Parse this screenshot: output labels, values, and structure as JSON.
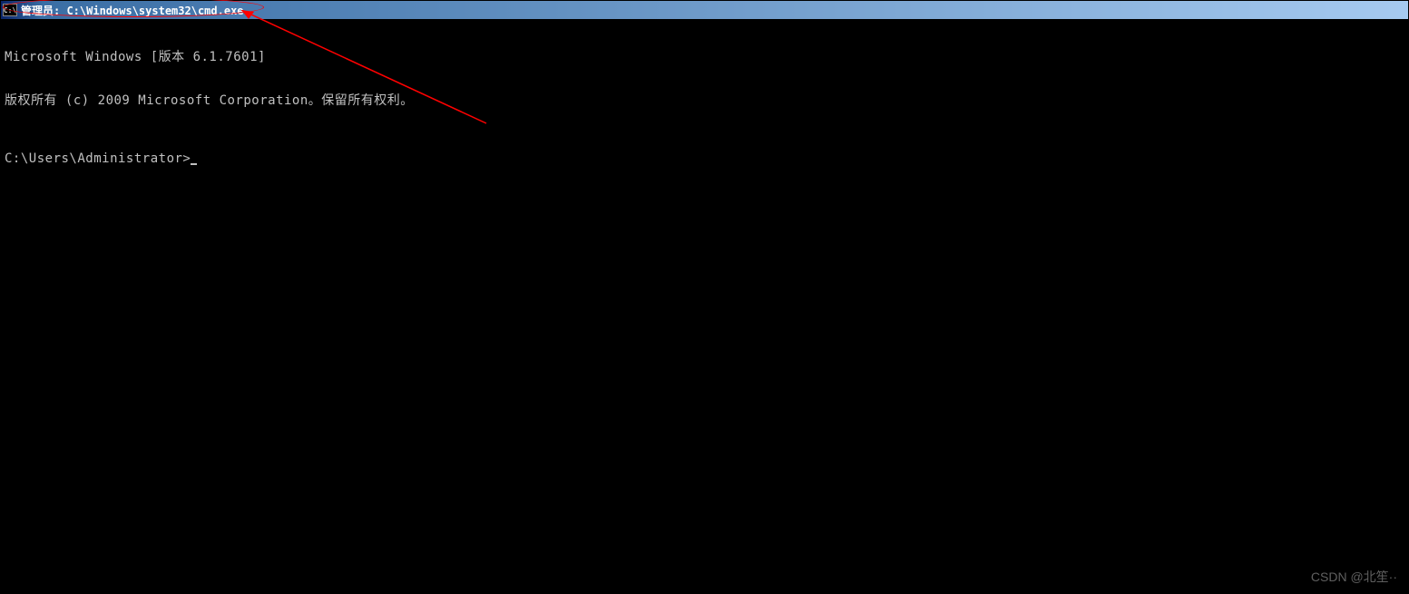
{
  "window": {
    "title": "管理员: C:\\Windows\\system32\\cmd.exe",
    "icon_label": "C:\\"
  },
  "terminal": {
    "line1": "Microsoft Windows [版本 6.1.7601]",
    "line2": "版权所有 (c) 2009 Microsoft Corporation。保留所有权利。",
    "prompt": "C:\\Users\\Administrator>"
  },
  "watermark": "CSDN @北笙··"
}
